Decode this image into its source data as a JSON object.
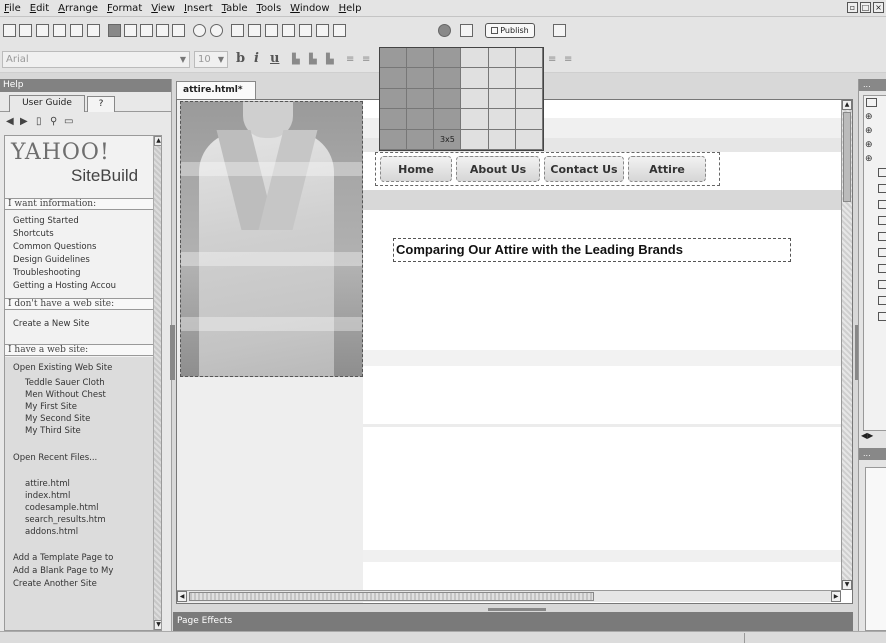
{
  "menubar": {
    "items": [
      "File",
      "Edit",
      "Arrange",
      "Format",
      "View",
      "Insert",
      "Table",
      "Tools",
      "Window",
      "Help"
    ]
  },
  "toolbar": {
    "publish_label": "Publish"
  },
  "format_toolbar": {
    "font_value": "Arial",
    "size_value": "10",
    "bold": "b",
    "italic": "i",
    "underline": "u"
  },
  "table_picker": {
    "rows": 5,
    "cols": 6,
    "selected_label": "3x5"
  },
  "help_panel": {
    "title": "Help",
    "tab_user_guide": "User Guide",
    "tab_help_icon": "?",
    "logo": "YAHOO!",
    "logo_sub": "SiteBuild",
    "sections": [
      {
        "heading": "I want information:",
        "items": [
          "Getting Started",
          "Shortcuts",
          "Common Questions",
          "Design Guidelines",
          "Troubleshooting",
          "Getting a Hosting Accou"
        ]
      },
      {
        "heading": "I don't have a web site:",
        "items": [
          "Create a New Site"
        ]
      },
      {
        "heading": "I have a web site:",
        "items": [
          "Open Existing Web Site",
          "Teddle Sauer Cloth",
          "Men Without Chest",
          "My First Site",
          "My Second Site",
          "My Third Site",
          "Open Recent Files...",
          "attire.html",
          "index.html",
          "codesample.html",
          "search_results.htm",
          "addons.html",
          "Add a Template Page to",
          "Add a Blank Page to My",
          "Create Another Site"
        ]
      }
    ]
  },
  "document": {
    "tab_label": "attire.html*",
    "nav_buttons": [
      "Home",
      "About Us",
      "Contact Us",
      "Attire"
    ],
    "heading": "Comparing Our Attire with the Leading Brands"
  },
  "bottom_panel": {
    "title": "Page Effects"
  },
  "right_panel": {
    "title": "...",
    "title2": "..."
  },
  "colors": {
    "panel_title_bg": "#828282",
    "page_effects_bg": "#7a7a7a",
    "picker_selected": "#9a9a9a"
  }
}
